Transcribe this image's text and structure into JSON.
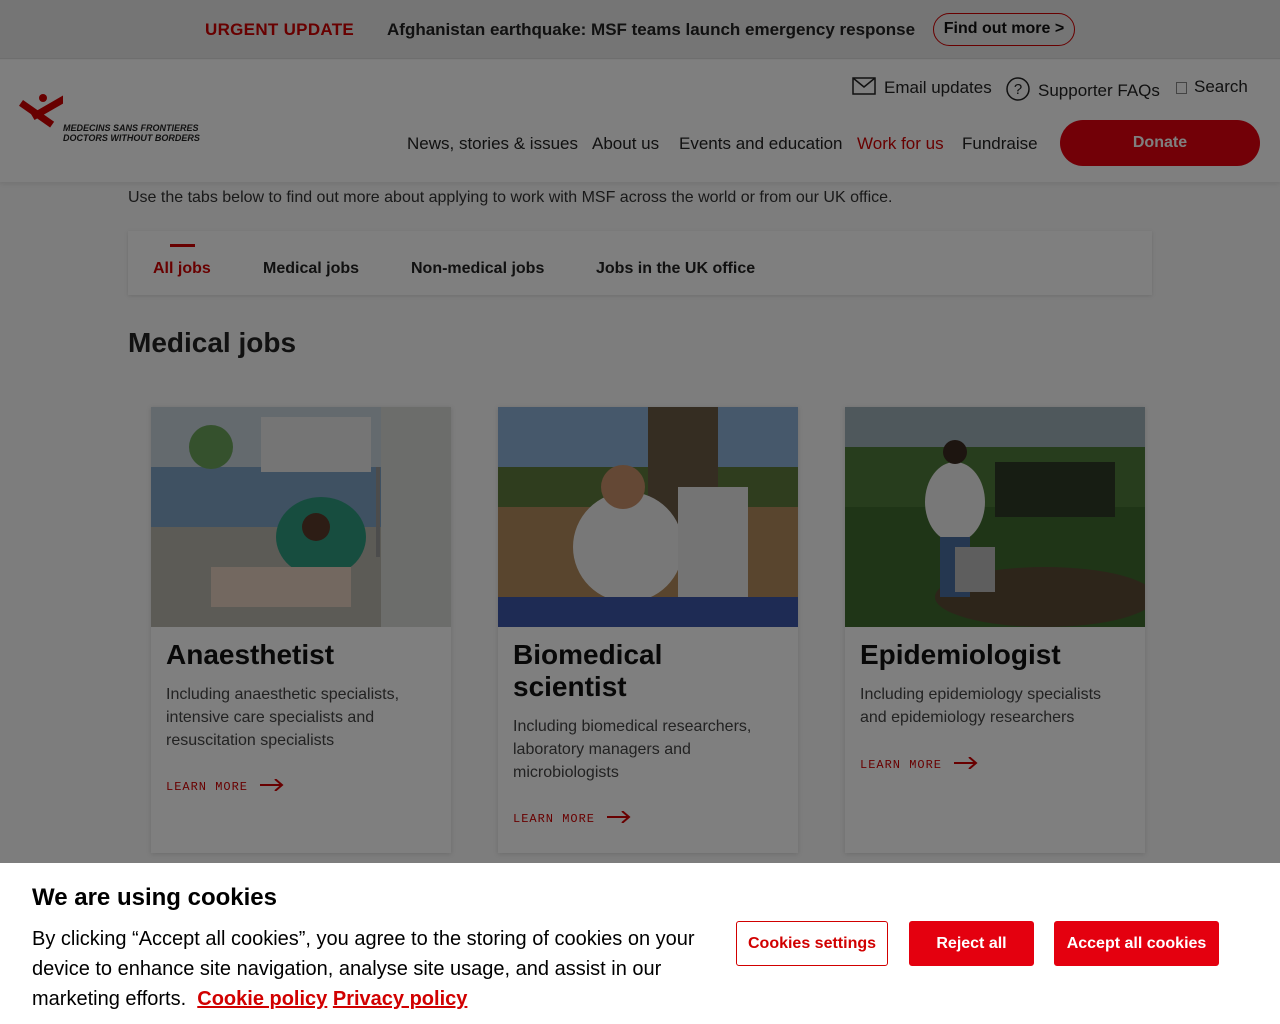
{
  "urgent_bar": {
    "tag": "URGENT UPDATE",
    "message": "Afghanistan earthquake: MSF teams launch emergency response",
    "cta": "Find out more >"
  },
  "header": {
    "logo_line1": "MEDECINS SANS FRONTIERES",
    "logo_line2": "DOCTORS WITHOUT BORDERS",
    "utility": {
      "email": "Email updates",
      "faq": "Supporter FAQs",
      "search": "Search"
    },
    "nav": [
      {
        "label": "News, stories & issues"
      },
      {
        "label": "About us"
      },
      {
        "label": "Events and education"
      },
      {
        "label": "Work for us",
        "active": true
      },
      {
        "label": "Fundraise"
      }
    ],
    "donate": "Donate"
  },
  "intro": "Use the tabs below to find out more about applying to work with MSF across the world or from our UK office.",
  "tabs": [
    {
      "label": "All jobs",
      "active": true
    },
    {
      "label": "Medical jobs"
    },
    {
      "label": "Non-medical jobs"
    },
    {
      "label": "Jobs in the UK office"
    }
  ],
  "section_title": "Medical jobs",
  "cards": [
    {
      "title": "Anaesthetist",
      "desc": "Including anaesthetic specialists, intensive care specialists and resuscitation specialists",
      "link": "LEARN MORE"
    },
    {
      "title": "Biomedical scientist",
      "desc": "Including biomedical researchers, laboratory managers and microbiologists",
      "link": "LEARN MORE"
    },
    {
      "title": "Epidemiologist",
      "desc": "Including epidemiology specialists and epidemiology researchers",
      "link": "LEARN MORE"
    }
  ],
  "cookie": {
    "title": "We are using cookies",
    "body": "By clicking “Accept all cookies”, you agree to the storing of cookies on your device to enhance site navigation, analyse site usage, and assist in our marketing efforts.",
    "cookie_policy": "Cookie policy",
    "privacy_policy": "Privacy policy",
    "settings": "Cookies settings",
    "reject": "Reject all",
    "accept": "Accept all cookies"
  },
  "colors": {
    "brand_red": "#e4000f",
    "overlay": "rgba(0,0,0,0.5)"
  }
}
